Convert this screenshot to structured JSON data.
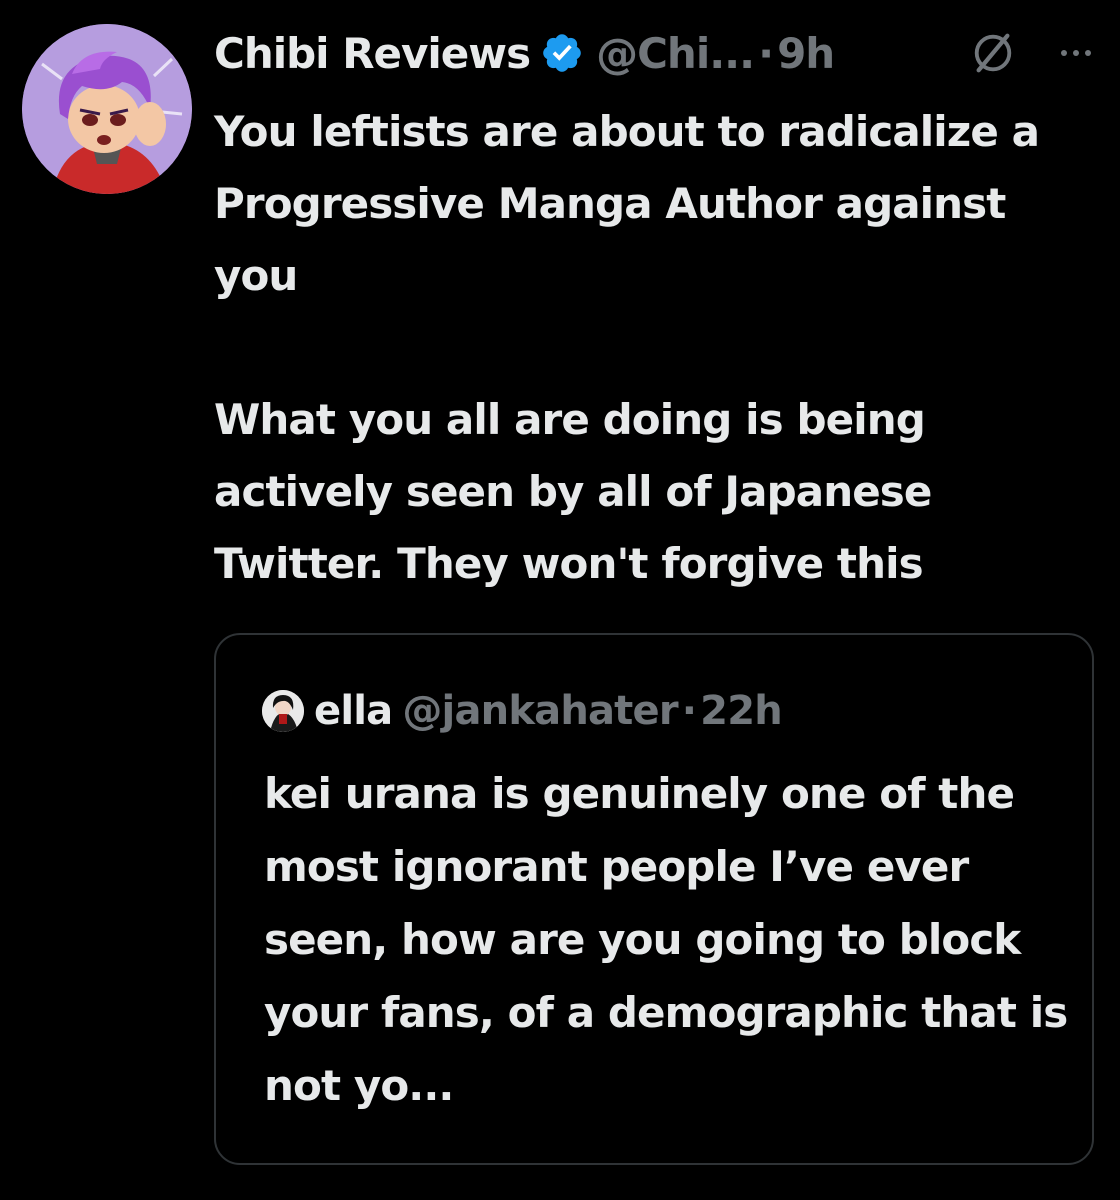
{
  "tweet": {
    "display_name": "Chibi Reviews",
    "handle": "@Chi...",
    "separator": "·",
    "timestamp": "9h",
    "avatar_icon": "cartoon-avatar-purple-hair",
    "verified_icon": "verified-badge-icon",
    "verified_color": "#1d9bf0",
    "paragraphs": [
      "You leftists are about to radicalize a Progressive Manga Author against you",
      "What you all are doing is being actively seen by all of Japanese Twitter. They won't forgive this"
    ]
  },
  "quote": {
    "display_name": "ella",
    "handle": "@jankahater",
    "separator": "·",
    "timestamp": "22h",
    "avatar_icon": "anime-character-avatar",
    "text": "kei urana is genuinely one of the most ignorant people I’ve ever seen, how are you going to block your fans, of a demographic that is not yo..."
  },
  "icons": {
    "grok": "grok-icon",
    "more": "more-options-icon"
  },
  "colors": {
    "background": "#000000",
    "text_primary": "#e7e9ea",
    "text_secondary": "#71767b",
    "border": "#2f3336",
    "accent": "#1d9bf0"
  }
}
